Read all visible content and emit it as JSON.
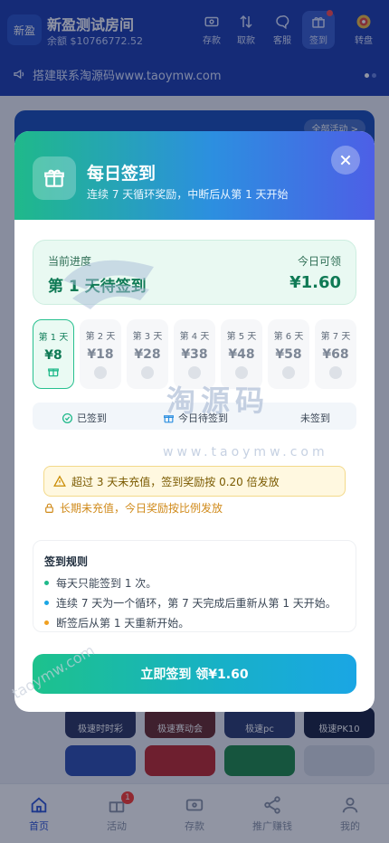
{
  "header": {
    "logo_text": "新盈",
    "room_name": "新盈测试房间",
    "balance_line": "余额 $10766772.52",
    "buttons": [
      {
        "label": "存款",
        "icon": "deposit-icon"
      },
      {
        "label": "取款",
        "icon": "withdraw-icon"
      },
      {
        "label": "客服",
        "icon": "chat-icon"
      },
      {
        "label": "签到",
        "icon": "gift-icon"
      },
      {
        "label": "转盘",
        "icon": "wheel-icon"
      }
    ]
  },
  "notice": {
    "text": "搭建联系淘源码www.taoymw.com"
  },
  "behind": {
    "all_activities": "全部活动 >"
  },
  "modal": {
    "title": "每日签到",
    "subtitle": "连续 7 天循环奖励，中断后从第 1 天开始",
    "progress_label": "当前进度",
    "progress_value": "第 1 天待签到",
    "today_label": "今日可领",
    "today_value": "¥1.60",
    "days": [
      {
        "label": "第 1 天",
        "amount": "¥8",
        "state": "current"
      },
      {
        "label": "第 2 天",
        "amount": "¥18",
        "state": "pending"
      },
      {
        "label": "第 3 天",
        "amount": "¥28",
        "state": "pending"
      },
      {
        "label": "第 4 天",
        "amount": "¥38",
        "state": "pending"
      },
      {
        "label": "第 5 天",
        "amount": "¥48",
        "state": "pending"
      },
      {
        "label": "第 6 天",
        "amount": "¥58",
        "state": "pending"
      },
      {
        "label": "第 7 天",
        "amount": "¥68",
        "state": "pending"
      }
    ],
    "legend": {
      "signed": "已签到",
      "today": "今日待签到",
      "unsigned": "未签到"
    },
    "warning": "超过 3 天未充值，签到奖励按 0.20 倍发放",
    "lock_note": "长期未充值，今日奖励按比例发放",
    "rules_title": "签到规则",
    "rules": [
      {
        "text": "每天只能签到 1 次。",
        "color": "#1fb98a"
      },
      {
        "text": "连续 7 天为一个循环，第 7 天完成后重新从第 1 天开始。",
        "color": "#1aa6e4"
      },
      {
        "text": "断签后从第 1 天重新开始。",
        "color": "#f0a020"
      }
    ],
    "cta_label": "立即签到 领¥1.60"
  },
  "background_tiles": [
    "极速时时彩",
    "极速赛动会",
    "极速pc",
    "极速PK10"
  ],
  "watermark": {
    "main": "淘源码",
    "url": "www.taoymw.com",
    "diagonal": "taoymw.com"
  },
  "bottom_nav": [
    {
      "label": "首页",
      "icon": "home-icon",
      "active": true
    },
    {
      "label": "活动",
      "icon": "gift-icon",
      "badge": "1"
    },
    {
      "label": "存款",
      "icon": "wallet-icon"
    },
    {
      "label": "推广赚钱",
      "icon": "share-icon"
    },
    {
      "label": "我的",
      "icon": "user-icon"
    }
  ],
  "colors": {
    "accent": "#1fb98a",
    "brand_blue": "#1e3fb0",
    "cta_end": "#1aa6e4"
  }
}
